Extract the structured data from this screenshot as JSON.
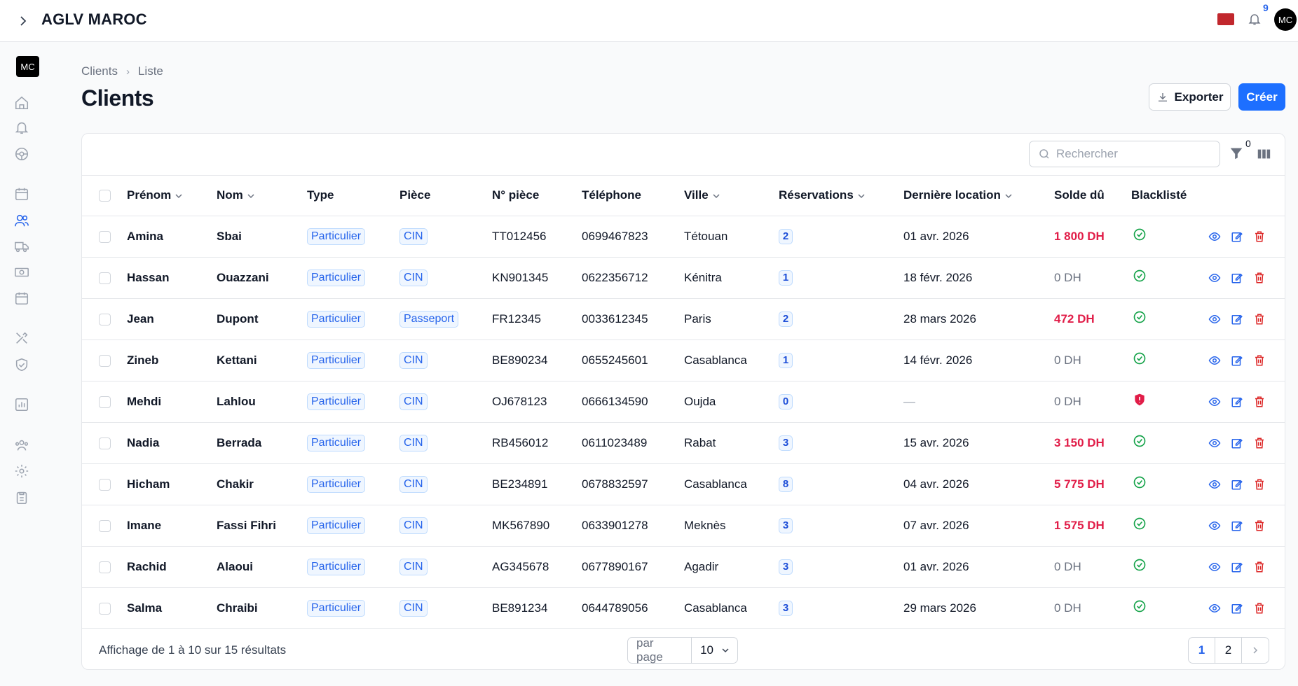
{
  "app": {
    "title": "AGLV MAROC",
    "notif_count": "9",
    "avatar": "MC",
    "sidebar_logo": "MC"
  },
  "breadcrumb": {
    "root": "Clients",
    "current": "Liste"
  },
  "page": {
    "title": "Clients"
  },
  "actions": {
    "export_label": "Exporter",
    "create_label": "Créer"
  },
  "search": {
    "placeholder": "Rechercher"
  },
  "filter": {
    "count": "0"
  },
  "columns": [
    "Prénom",
    "Nom",
    "Type",
    "Pièce",
    "N° pièce",
    "Téléphone",
    "Ville",
    "Réservations",
    "Dernière location",
    "Solde dû",
    "Blacklisté"
  ],
  "rows": [
    {
      "prenom": "Amina",
      "nom": "Sbai",
      "type": "Particulier",
      "piece": "CIN",
      "num": "TT012456",
      "tel": "0699467823",
      "ville": "Tétouan",
      "res": "2",
      "last": "01 avr. 2026",
      "solde": "1 800 DH",
      "due": true,
      "black": false
    },
    {
      "prenom": "Hassan",
      "nom": "Ouazzani",
      "type": "Particulier",
      "piece": "CIN",
      "num": "KN901345",
      "tel": "0622356712",
      "ville": "Kénitra",
      "res": "1",
      "last": "18 févr. 2026",
      "solde": "0 DH",
      "due": false,
      "black": false
    },
    {
      "prenom": "Jean",
      "nom": "Dupont",
      "type": "Particulier",
      "piece": "Passeport",
      "num": "FR12345",
      "tel": "0033612345",
      "ville": "Paris",
      "res": "2",
      "last": "28 mars 2026",
      "solde": "472 DH",
      "due": true,
      "black": false
    },
    {
      "prenom": "Zineb",
      "nom": "Kettani",
      "type": "Particulier",
      "piece": "CIN",
      "num": "BE890234",
      "tel": "0655245601",
      "ville": "Casablanca",
      "res": "1",
      "last": "14 févr. 2026",
      "solde": "0 DH",
      "due": false,
      "black": false
    },
    {
      "prenom": "Mehdi",
      "nom": "Lahlou",
      "type": "Particulier",
      "piece": "CIN",
      "num": "OJ678123",
      "tel": "0666134590",
      "ville": "Oujda",
      "res": "0",
      "last": "—",
      "solde": "0 DH",
      "due": false,
      "black": true
    },
    {
      "prenom": "Nadia",
      "nom": "Berrada",
      "type": "Particulier",
      "piece": "CIN",
      "num": "RB456012",
      "tel": "0611023489",
      "ville": "Rabat",
      "res": "3",
      "last": "15 avr. 2026",
      "solde": "3 150 DH",
      "due": true,
      "black": false
    },
    {
      "prenom": "Hicham",
      "nom": "Chakir",
      "type": "Particulier",
      "piece": "CIN",
      "num": "BE234891",
      "tel": "0678832597",
      "ville": "Casablanca",
      "res": "8",
      "last": "04 avr. 2026",
      "solde": "5 775 DH",
      "due": true,
      "black": false
    },
    {
      "prenom": "Imane",
      "nom": "Fassi Fihri",
      "type": "Particulier",
      "piece": "CIN",
      "num": "MK567890",
      "tel": "0633901278",
      "ville": "Meknès",
      "res": "3",
      "last": "07 avr. 2026",
      "solde": "1 575 DH",
      "due": true,
      "black": false
    },
    {
      "prenom": "Rachid",
      "nom": "Alaoui",
      "type": "Particulier",
      "piece": "CIN",
      "num": "AG345678",
      "tel": "0677890167",
      "ville": "Agadir",
      "res": "3",
      "last": "01 avr. 2026",
      "solde": "0 DH",
      "due": false,
      "black": false
    },
    {
      "prenom": "Salma",
      "nom": "Chraibi",
      "type": "Particulier",
      "piece": "CIN",
      "num": "BE891234",
      "tel": "0644789056",
      "ville": "Casablanca",
      "res": "3",
      "last": "29 mars 2026",
      "solde": "0 DH",
      "due": false,
      "black": false
    }
  ],
  "footer": {
    "summary": "Affichage de 1 à 10 sur 15 résultats",
    "per_page_label": "par page",
    "per_page_value": "10",
    "pages": [
      "1",
      "2"
    ],
    "current_page": "1"
  },
  "colors": {
    "accent": "#1d6fff",
    "due": "#e11d48",
    "ok": "#16a34a",
    "danger": "#dc2626"
  }
}
